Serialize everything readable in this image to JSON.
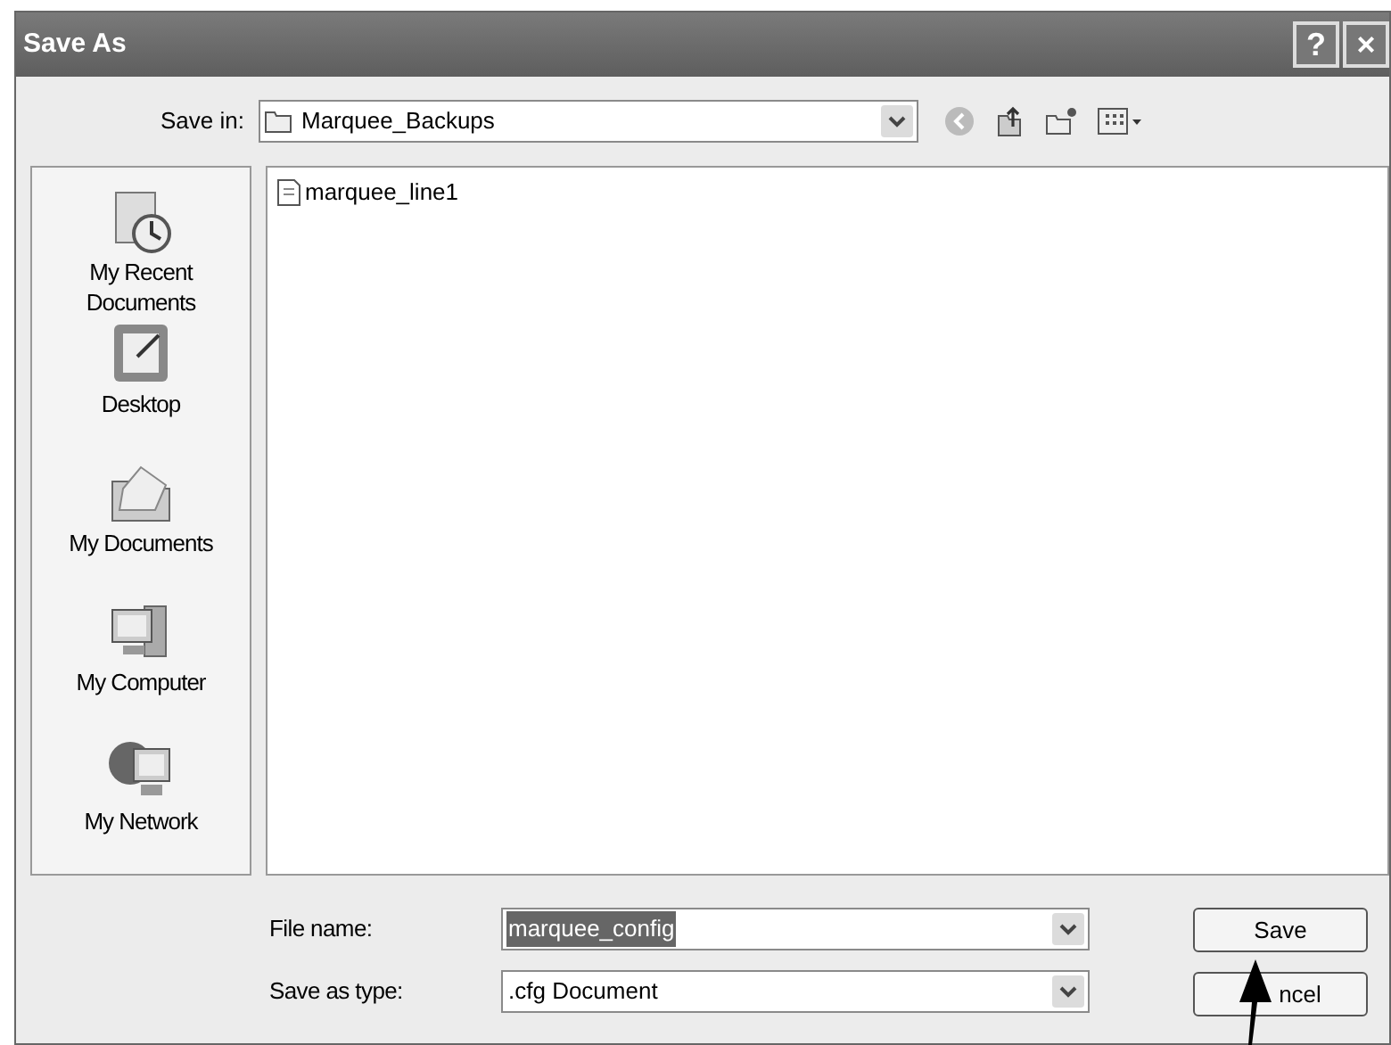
{
  "window": {
    "title": "Save As",
    "title_buttons": [
      "?",
      "×"
    ]
  },
  "save_in": {
    "label": "Save in:",
    "value": "Marquee_Backups"
  },
  "files": [
    {
      "name": "marquee_line1",
      "selected": false
    }
  ],
  "places": [
    {
      "label": "My Recent Documents",
      "kind": "recent"
    },
    {
      "label": "Desktop",
      "kind": "desktop"
    },
    {
      "label": "My Documents",
      "kind": "documents"
    },
    {
      "label": "My Computer",
      "kind": "computer"
    },
    {
      "label": "My Network",
      "kind": "network"
    }
  ],
  "file_name": {
    "label": "File name:",
    "value": "marquee_config",
    "text_selected": true
  },
  "save_type": {
    "label": "Save as type:",
    "value": ".cfg Document"
  },
  "buttons": [
    {
      "label": "Save",
      "kind": "save"
    },
    {
      "label": "ncel",
      "kind": "cancel"
    }
  ]
}
